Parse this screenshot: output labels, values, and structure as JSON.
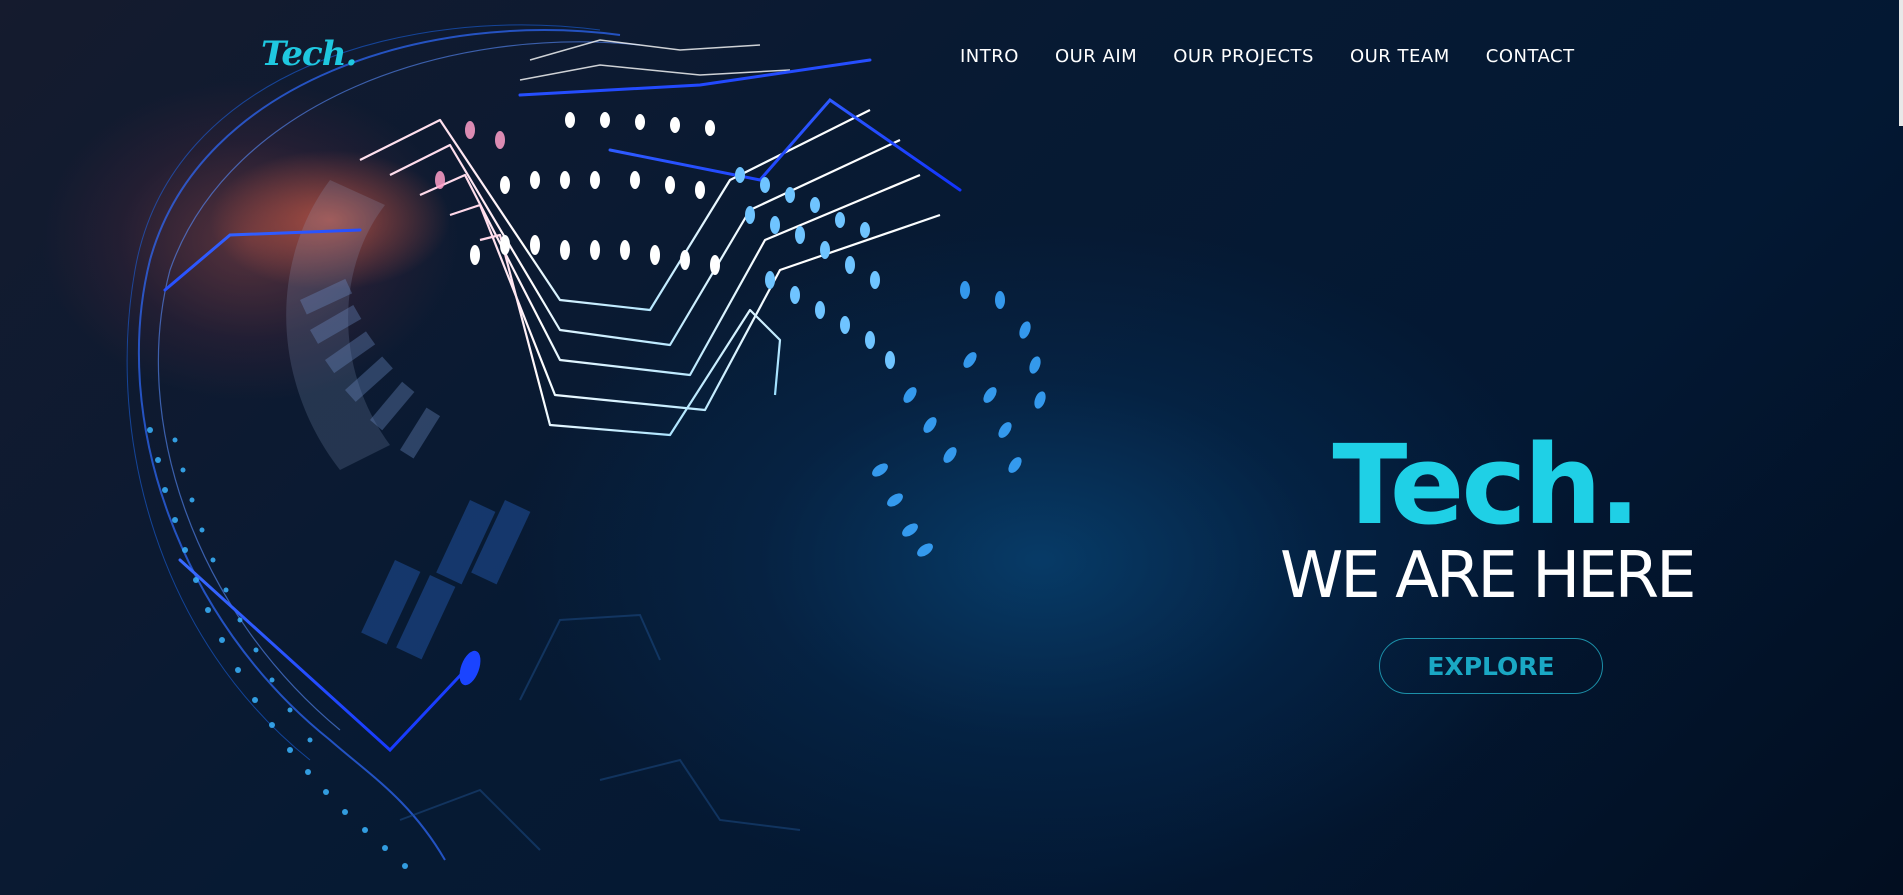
{
  "logo": {
    "text": "Tech."
  },
  "nav": {
    "items": [
      {
        "label": "INTRO"
      },
      {
        "label": "OUR AIM"
      },
      {
        "label": "OUR PROJECTS"
      },
      {
        "label": "OUR TEAM"
      },
      {
        "label": "CONTACT"
      }
    ]
  },
  "hero": {
    "title": "Tech.",
    "subtitle": "WE ARE HERE",
    "cta_label": "EXPLORE"
  },
  "colors": {
    "accent": "#1fd0e6",
    "background": "#03142a",
    "text": "#ffffff",
    "button_border": "#1c8fa8"
  },
  "decor": {
    "background_art": "circuit-globe-illustration"
  }
}
